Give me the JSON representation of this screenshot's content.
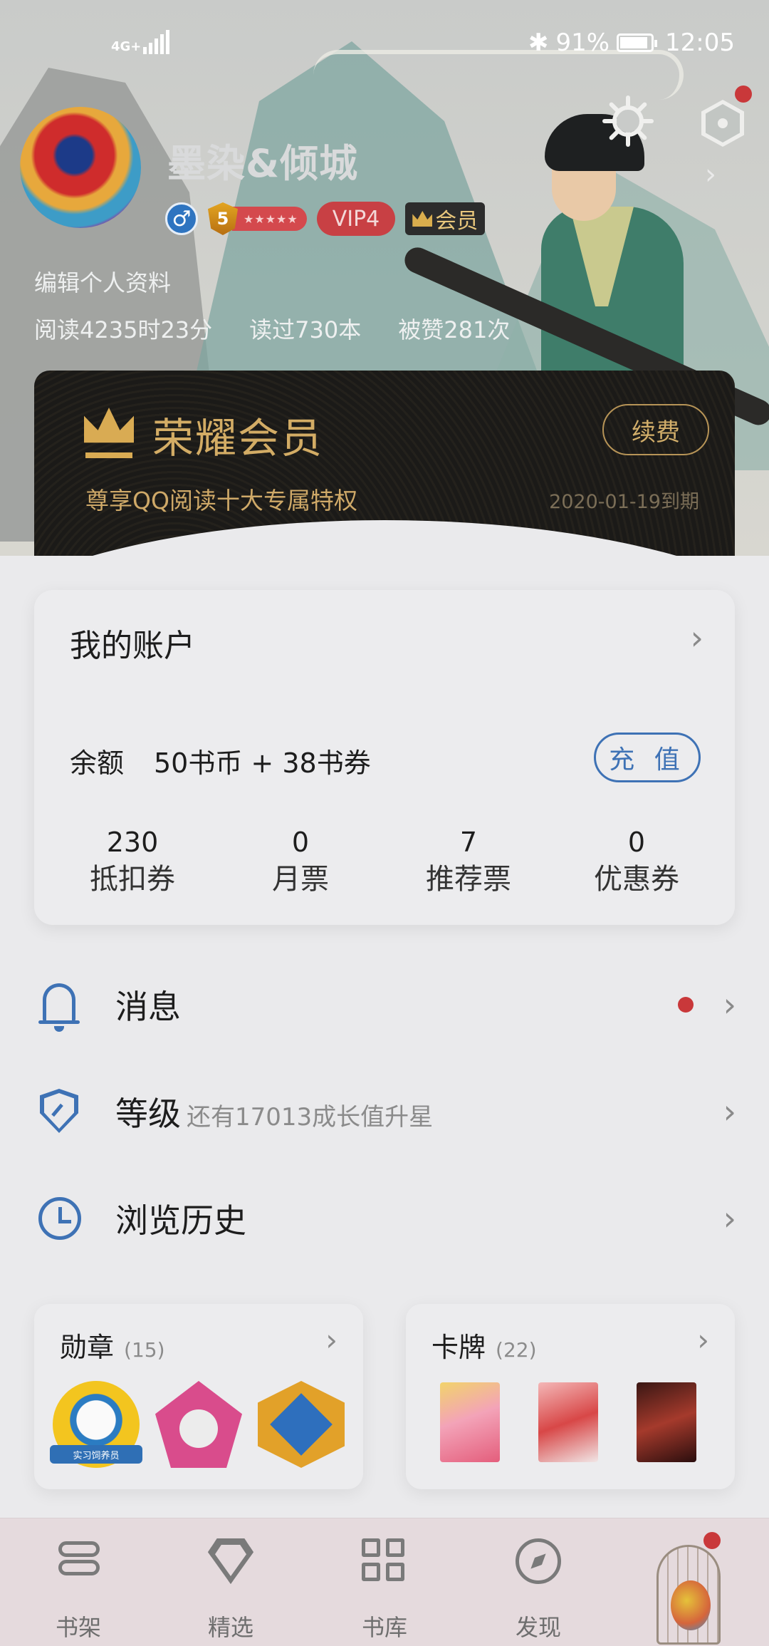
{
  "status_bar": {
    "network": "4G+",
    "battery": "91%",
    "time": "12:05",
    "battery_level": 0.91
  },
  "profile": {
    "username": "墨染&倾城",
    "gender_symbol": "♂",
    "level": "5",
    "level_stars": "★★★★★",
    "vip_label": "VIP4",
    "member_label": "会员",
    "edit_label": "编辑个人资料",
    "stats": {
      "reading_time": "阅读4235时23分",
      "books_read": "读过730本",
      "likes": "被赞281次"
    }
  },
  "vip_card": {
    "title": "荣耀会员",
    "subtitle": "尊享QQ阅读十大专属特权",
    "renew_label": "续费",
    "expire": "2020-01-19到期"
  },
  "account": {
    "title": "我的账户",
    "balance_label": "余额",
    "balance_value": "50书币 + 38书券",
    "recharge_label": "充 值",
    "stats": [
      {
        "num": "230",
        "label": "抵扣券"
      },
      {
        "num": "0",
        "label": "月票"
      },
      {
        "num": "7",
        "label": "推荐票"
      },
      {
        "num": "0",
        "label": "优惠券"
      }
    ]
  },
  "menu": {
    "messages": "消息",
    "level": "等级",
    "level_sub": "还有17013成长值升星",
    "history": "浏览历史"
  },
  "medals": {
    "title": "勋章",
    "count": "(15)",
    "penguin_ribbon": "实习饲养员"
  },
  "cards": {
    "title": "卡牌",
    "count": "(22)"
  },
  "bottom_nav": {
    "shelf": "书架",
    "featured": "精选",
    "library": "书库",
    "discover": "发现"
  },
  "colors": {
    "accent": "#3e72b5",
    "gold": "#d3ac65",
    "red_dot": "#c9383a"
  }
}
